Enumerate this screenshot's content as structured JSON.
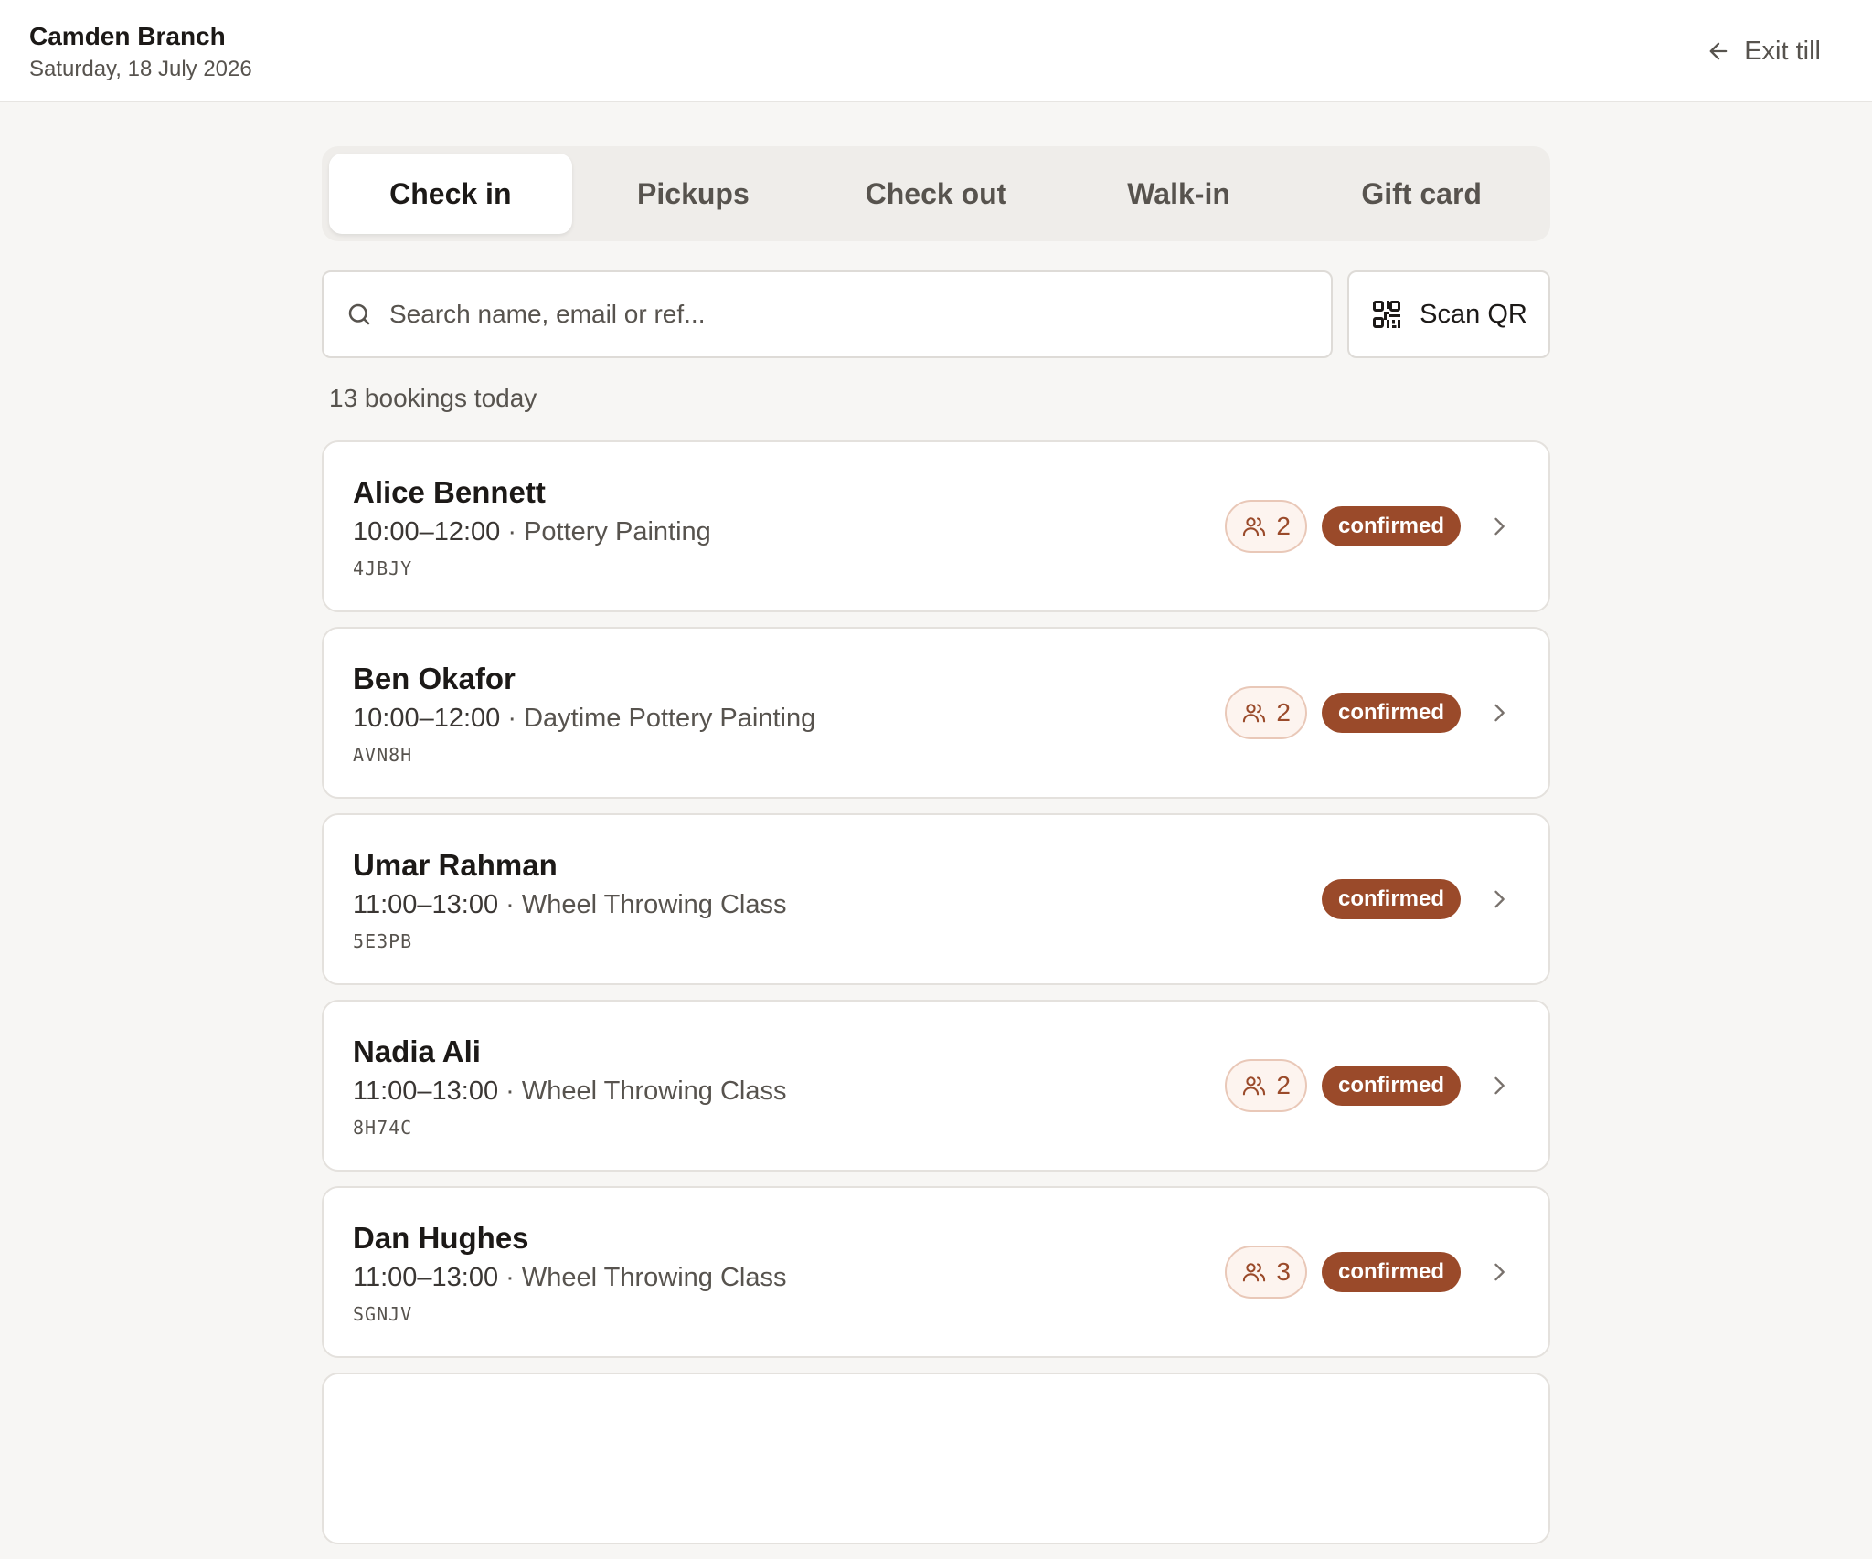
{
  "header": {
    "branch": "Camden Branch",
    "date": "Saturday, 18 July 2026",
    "exit_label": "Exit till"
  },
  "tabs": [
    {
      "label": "Check in",
      "active": true
    },
    {
      "label": "Pickups",
      "active": false
    },
    {
      "label": "Check out",
      "active": false
    },
    {
      "label": "Walk-in",
      "active": false
    },
    {
      "label": "Gift card",
      "active": false
    }
  ],
  "search": {
    "placeholder": "Search name, email or ref...",
    "value": "",
    "icon": "search-icon"
  },
  "scan": {
    "label": "Scan QR",
    "icon": "qr-code-icon"
  },
  "bookings_count": "13 bookings today",
  "bookings": [
    {
      "name": "Alice Bennett",
      "time": "10:00–12:00",
      "separator": " · ",
      "activity": "Pottery Painting",
      "ref": "4JBJY",
      "guests": "2",
      "status": "confirmed"
    },
    {
      "name": "Ben Okafor",
      "time": "10:00–12:00",
      "separator": " · ",
      "activity": "Daytime Pottery Painting",
      "ref": "AVN8H",
      "guests": "2",
      "status": "confirmed"
    },
    {
      "name": "Umar Rahman",
      "time": "11:00–13:00",
      "separator": " · ",
      "activity": "Wheel Throwing Class",
      "ref": "5E3PB",
      "guests": null,
      "status": "confirmed"
    },
    {
      "name": "Nadia Ali",
      "time": "11:00–13:00",
      "separator": " · ",
      "activity": "Wheel Throwing Class",
      "ref": "8H74C",
      "guests": "2",
      "status": "confirmed"
    },
    {
      "name": "Dan Hughes",
      "time": "11:00–13:00",
      "separator": " · ",
      "activity": "Wheel Throwing Class",
      "ref": "SGNJV",
      "guests": "3",
      "status": "confirmed"
    }
  ],
  "colors": {
    "accent": "#9a4a2a",
    "background": "#f7f6f4",
    "card": "#ffffff",
    "muted_text": "#57534e"
  }
}
